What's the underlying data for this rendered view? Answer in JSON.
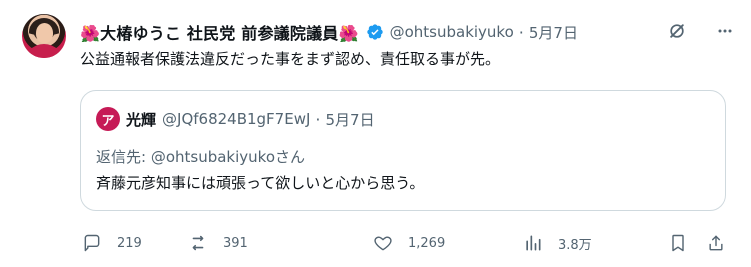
{
  "author": {
    "display_name": "🌺大椿ゆうこ 社民党 前参議院議員🌺",
    "handle": "@ohtsubakiyuko",
    "time": "5月7日",
    "verified": true
  },
  "tweet": {
    "text": "公益通報者保護法違反だった事をまず認め、責任取る事が先。"
  },
  "quote": {
    "avatar_letter": "ア",
    "display_name": "光輝",
    "handle": "@JQf6824B1gF7EwJ",
    "time": "5月7日",
    "replying_prefix": "返信先: ",
    "replying_to": "@ohtsubakiyukoさん",
    "text": "斉藤元彦知事には頑張って欲しいと心から思う。"
  },
  "actions": {
    "replies": "219",
    "reposts": "391",
    "likes": "1,269",
    "views": "3.8万"
  },
  "colors": {
    "text": "#0f1419",
    "muted": "#536471",
    "border": "#cfd9de",
    "verified": "#1d9bf0",
    "quote_avatar": "#c61a56"
  },
  "icons": {
    "more": "more-icon",
    "grok": "grok-icon",
    "reply": "reply-icon",
    "repost": "repost-icon",
    "like": "like-icon",
    "views": "views-icon",
    "bookmark": "bookmark-icon",
    "share": "share-icon",
    "verified": "verified-badge-icon"
  }
}
